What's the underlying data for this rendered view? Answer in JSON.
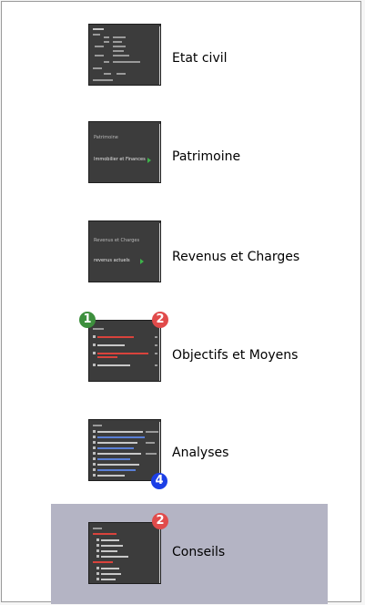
{
  "items": [
    {
      "label": "Etat civil"
    },
    {
      "label": "Patrimoine",
      "thumb_title": "Patrimoine",
      "thumb_sub": "Immobilier et Finances"
    },
    {
      "label": "Revenus et Charges",
      "thumb_title": "Revenus et Charges",
      "thumb_sub": "revenus actuels"
    },
    {
      "label": "Objectifs et Moyens",
      "badges": [
        "1",
        "2"
      ]
    },
    {
      "label": "Analyses",
      "badges": [
        "4"
      ]
    },
    {
      "label": "Conseils",
      "badges": [
        "2"
      ]
    }
  ],
  "colors": {
    "selected_bg": "#b4b4c4",
    "thumb_bg": "#3c3c3c",
    "badge_green": "#3d8f3d",
    "badge_red": "#e14b4b",
    "badge_blue": "#1c3fe6"
  },
  "selected_index": 5
}
